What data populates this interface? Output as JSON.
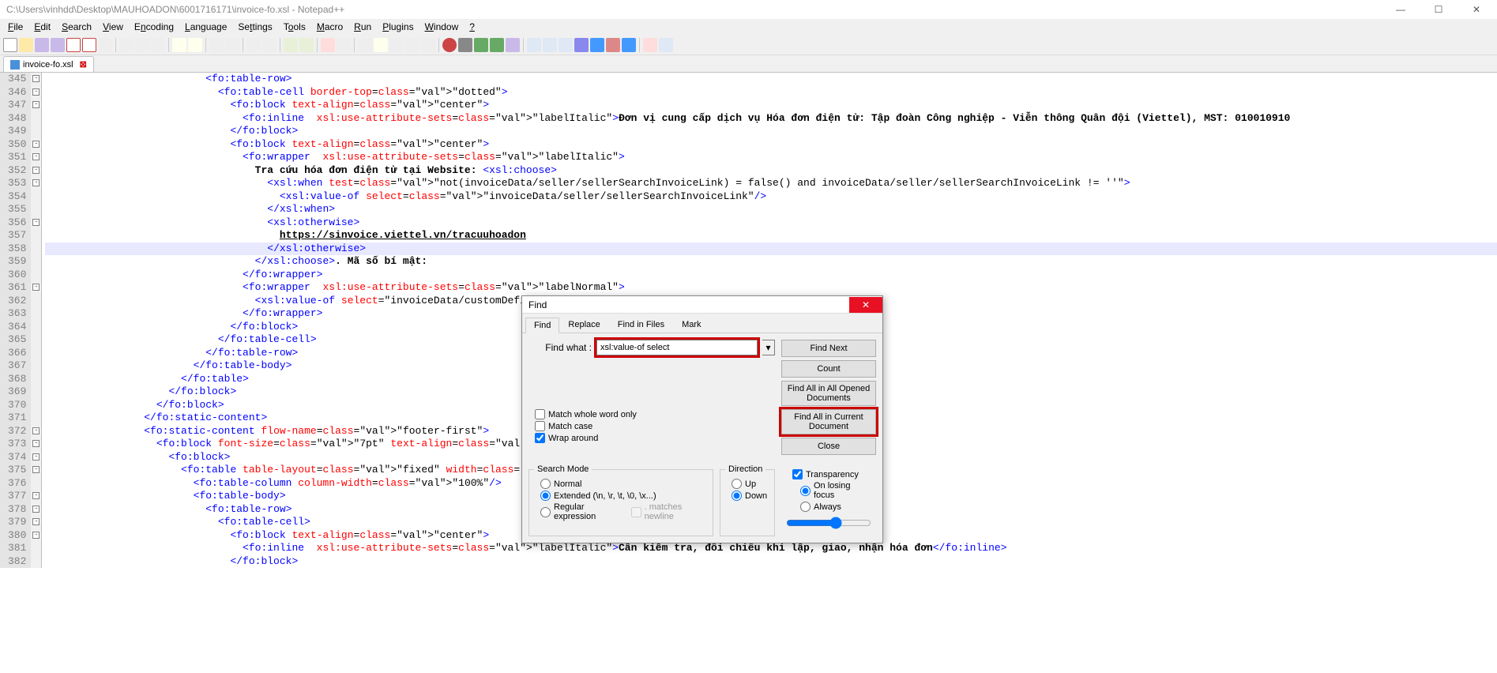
{
  "title": "C:\\Users\\vinhdd\\Desktop\\MAUHOADON\\6001716171\\invoice-fo.xsl - Notepad++",
  "menu": [
    "File",
    "Edit",
    "Search",
    "View",
    "Encoding",
    "Language",
    "Settings",
    "Tools",
    "Macro",
    "Run",
    "Plugins",
    "Window",
    "?"
  ],
  "tab": {
    "label": "invoice-fo.xsl"
  },
  "lines_start": 345,
  "lines_end": 382,
  "find": {
    "title": "Find",
    "tabs": [
      "Find",
      "Replace",
      "Find in Files",
      "Mark"
    ],
    "active_tab": 0,
    "label_find_what": "Find what :",
    "find_what": "xsl:value-of select",
    "buttons": {
      "find_next": "Find Next",
      "count": "Count",
      "find_all_opened": "Find All in All Opened Documents",
      "find_all_current": "Find All in Current Document",
      "close": "Close"
    },
    "checks": {
      "whole_word": "Match whole word only",
      "match_case": "Match case",
      "wrap_around": "Wrap around"
    },
    "search_mode": {
      "legend": "Search Mode",
      "normal": "Normal",
      "extended": "Extended (\\n, \\r, \\t, \\0, \\x...)",
      "regex": "Regular expression",
      "dot_newline": ". matches newline"
    },
    "direction": {
      "legend": "Direction",
      "up": "Up",
      "down": "Down"
    },
    "transparency": {
      "legend": "Transparency",
      "on_losing": "On losing focus",
      "always": "Always"
    }
  },
  "code": {
    "l345": "<fo:table-row>",
    "l346": "<fo:table-cell border-top=\"dotted\">",
    "l347": "<fo:block text-align=\"center\">",
    "l348_a": "<fo:inline  xsl:use-attribute-sets=\"labelItalic\">",
    "l348_t": "Đơn vị cung cấp dịch vụ Hóa đơn điện tử: Tập đoàn Công nghiệp - Viễn thông Quân đội (Viettel), MST: 010010910",
    "l349": "</fo:block>",
    "l350": "<fo:block text-align=\"center\">",
    "l351": "<fo:wrapper  xsl:use-attribute-sets=\"labelItalic\">",
    "l352_t": "Tra cứu hóa đơn điện tử tại Website: ",
    "l352_b": "<xsl:choose>",
    "l353": "<xsl:when test=\"not(invoiceData/seller/sellerSearchInvoiceLink) = false() and invoiceData/seller/sellerSearchInvoiceLink != ''\">",
    "l354": "<xsl:value-of select=\"invoiceData/seller/sellerSearchInvoiceLink\"/>",
    "l355": "</xsl:when>",
    "l356": "<xsl:otherwise>",
    "l357": "https://sinvoice.viettel.vn/tracuuhoadon",
    "l358": "</xsl:otherwise>",
    "l359_a": "</xsl:choose>",
    "l359_t": ". Mã số bí mật:",
    "l360": "</fo:wrapper>",
    "l361": "<fo:wrapper  xsl:use-attribute-sets=\"labelNormal\">",
    "l362": "<xsl:value-of select=\"invoiceData/customDefine",
    "l363": "</fo:wrapper>",
    "l364": "</fo:block>",
    "l365": "</fo:table-cell>",
    "l366": "</fo:table-row>",
    "l367": "</fo:table-body>",
    "l368": "</fo:table>",
    "l369": "</fo:block>",
    "l370": "</fo:block>",
    "l371": "</fo:static-content>",
    "l372": "<fo:static-content flow-name=\"footer-first\">",
    "l373": "<fo:block font-size=\"7pt\" text-align=\"right\">",
    "l374": "<fo:block>",
    "l375": "<fo:table table-layout=\"fixed\" width=\"100%\">",
    "l376": "<fo:table-column column-width=\"100%\"/>",
    "l377": "<fo:table-body>",
    "l378": "<fo:table-row>",
    "l379": "<fo:table-cell>",
    "l380": "<fo:block text-align=\"center\">",
    "l381_a": "<fo:inline  xsl:use-attribute-sets=\"labelItalic\">",
    "l381_t": "Cần kiểm tra, đối chiếu khi lập, giao, nhận hóa đơn",
    "l381_b": "</fo:inline>",
    "l382": "</fo:block>"
  },
  "indents": {
    "l345": 26,
    "l346": 28,
    "l347": 30,
    "l348": 32,
    "l349": 30,
    "l350": 30,
    "l351": 32,
    "l352": 34,
    "l353": 36,
    "l354": 38,
    "l355": 36,
    "l356": 36,
    "l357": 38,
    "l358": 36,
    "l359": 34,
    "l360": 32,
    "l361": 32,
    "l362": 34,
    "l363": 32,
    "l364": 30,
    "l365": 28,
    "l366": 26,
    "l367": 24,
    "l368": 22,
    "l369": 20,
    "l370": 18,
    "l371": 16,
    "l372": 16,
    "l373": 18,
    "l374": 20,
    "l375": 22,
    "l376": 24,
    "l377": 24,
    "l378": 26,
    "l379": 28,
    "l380": 30,
    "l381": 32,
    "l382": 30
  }
}
